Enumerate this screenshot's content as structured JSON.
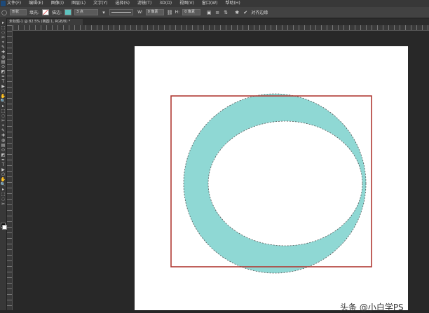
{
  "menu": {
    "items": [
      "文件(F)",
      "编辑(E)",
      "图像(I)",
      "图层(L)",
      "文字(Y)",
      "选择(S)",
      "滤镜(T)",
      "3D(D)",
      "视图(V)",
      "窗口(W)",
      "帮助(H)"
    ]
  },
  "options": {
    "mode_value": "形状",
    "fill_label": "填充:",
    "stroke_label": "描边:",
    "stroke_width": "3 点",
    "w_value": "0 像素",
    "h_value": "0 像素",
    "align_edges_label": "对齐边缘",
    "fill_color": "#ffffff",
    "stroke_color": "#5ec4c0"
  },
  "document": {
    "tab_label": "未标题-1 @ 82.5% (椭圆 1, RGB/8) *",
    "canvas_color": "#ffffff",
    "ring_color": "#8fd8d4",
    "box_color": "#b03a34"
  },
  "watermark": {
    "text": "头条 @小白学PS"
  }
}
